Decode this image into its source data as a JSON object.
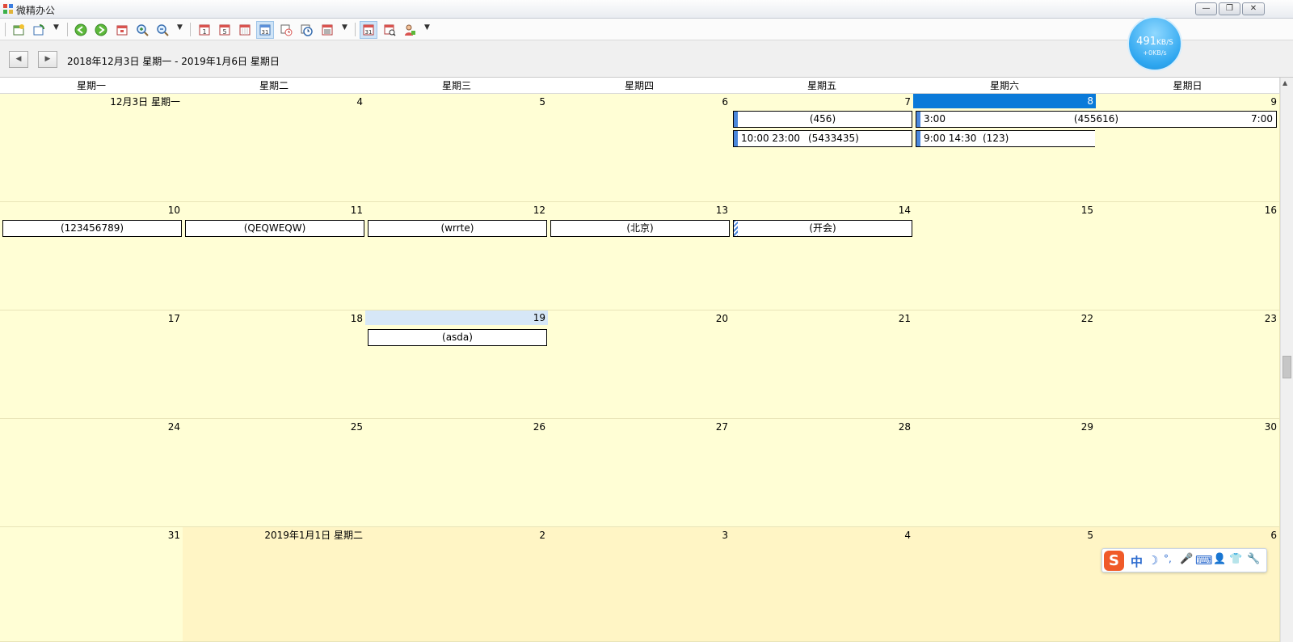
{
  "window": {
    "title": "微精办公",
    "min_label": "—",
    "restore_label": "❐",
    "close_label": "✕"
  },
  "navigation": {
    "prev_label": "◀",
    "next_label": "▶",
    "date_range": "2018年12月3日 星期一 - 2019年1月6日 星期日"
  },
  "calendar": {
    "weekdays": [
      "星期一",
      "星期二",
      "星期三",
      "星期四",
      "星期五",
      "星期六",
      "星期日"
    ],
    "weeks": [
      [
        "12月3日 星期一",
        "4",
        "5",
        "6",
        "7",
        "8",
        "9"
      ],
      [
        "10",
        "11",
        "12",
        "13",
        "14",
        "15",
        "16"
      ],
      [
        "17",
        "18",
        "19",
        "20",
        "21",
        "22",
        "23"
      ],
      [
        "24",
        "25",
        "26",
        "27",
        "28",
        "29",
        "30"
      ],
      [
        "31",
        "2019年1月1日 星期二",
        "2",
        "3",
        "4",
        "5",
        "6"
      ]
    ],
    "selected_day": "8",
    "today_day": "19",
    "appointments": {
      "fri7": "(456)",
      "fri7_times": "10:00  23:00",
      "fri7_title2": "(5433435)",
      "sat8_start": "3:00",
      "sat8_title": "(455616)",
      "sun9_end": "7:00",
      "sat8_times": "9:00  14:30",
      "sat8_title2": "(123)",
      "mon10": "(123456789)",
      "tue11": "(QEQWEQW)",
      "wed12": "(wrrte)",
      "thu13": "(北京)",
      "fri14": "(开会)",
      "wed19": "(asda)"
    }
  },
  "network_widget": {
    "speed_value": "491",
    "speed_unit": "KB/S",
    "upload": "+0KB/s"
  },
  "ime_toolbar": {
    "logo": "S",
    "lang": "中",
    "moon": "☽",
    "punct": "°,",
    "mic": "🎤",
    "keyboard": "⌨",
    "user": "👤",
    "shirt": "👕",
    "tool": "🔧"
  },
  "colors": {
    "cell_bg": "#fffed5",
    "other_month_bg": "#fff5c5",
    "selected_bg": "#0a7ad9",
    "today_bg": "#d6e7f7",
    "appt_bar": "#4a87db"
  }
}
